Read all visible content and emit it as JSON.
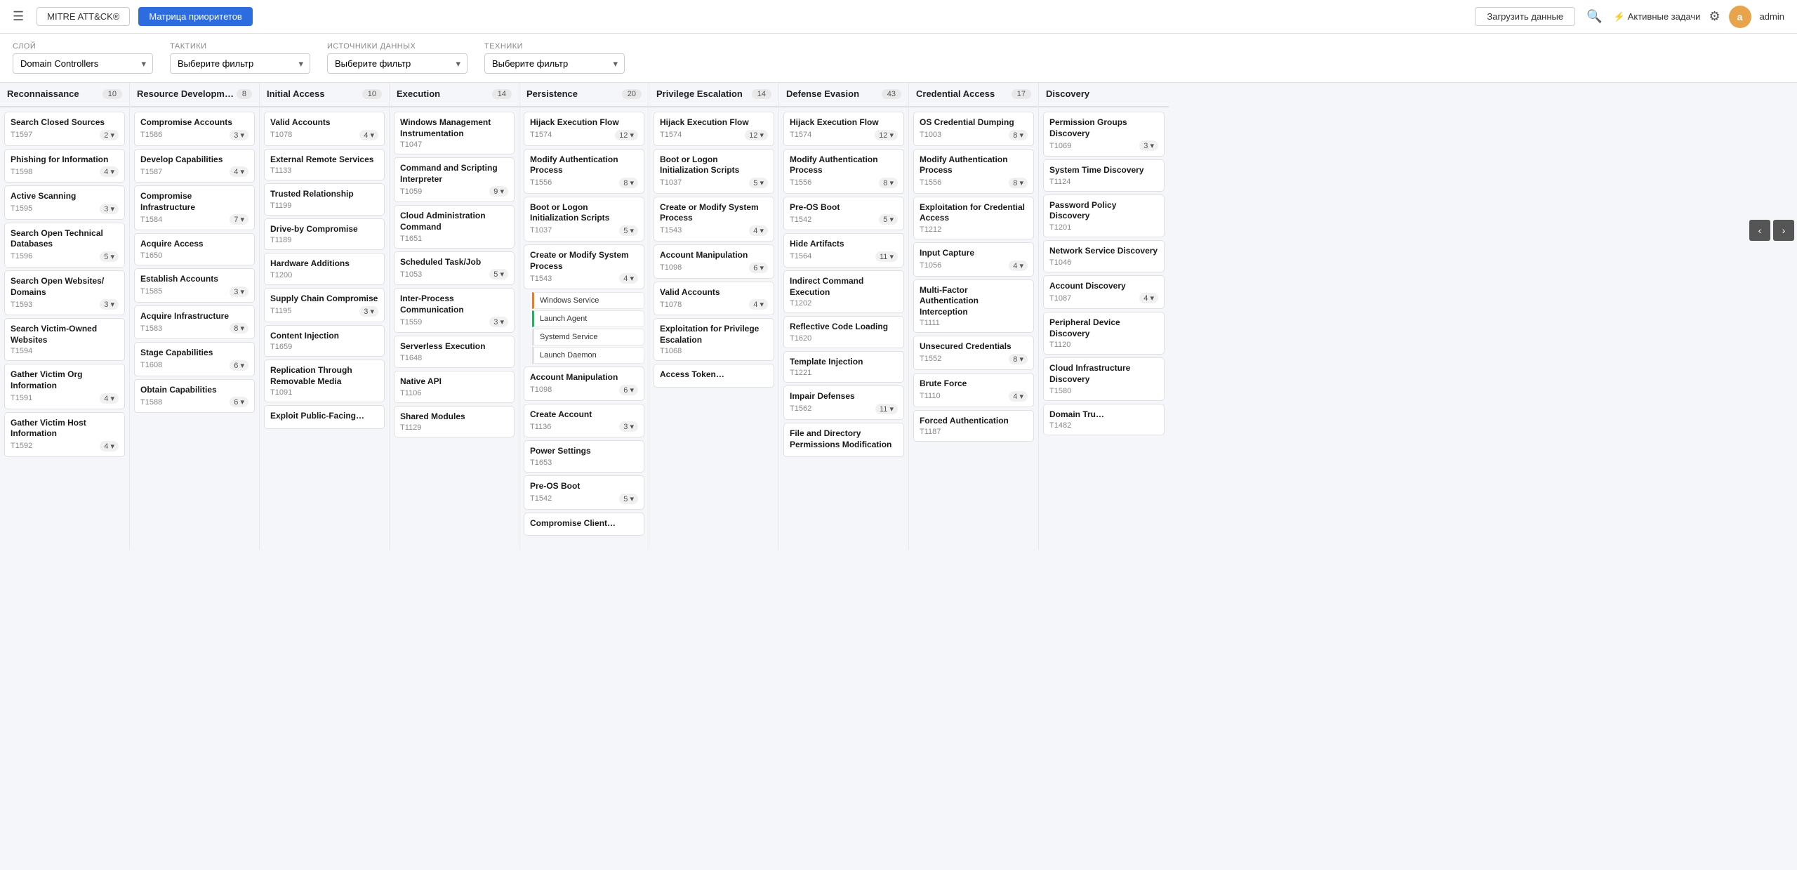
{
  "header": {
    "menu_icon": "☰",
    "brand": "MITRE ATT&CK®",
    "priority_matrix_tab": "Матрица приоритетов",
    "upload_btn": "Загрузить данные",
    "search_icon": "🔍",
    "active_tasks_label": "Активные задачи",
    "settings_icon": "⚙",
    "avatar_letter": "a",
    "admin_label": "admin"
  },
  "filters": {
    "layer_label": "Слой",
    "layer_value": "Domain Controllers",
    "tactics_label": "Тактики",
    "tactics_placeholder": "Выберите фильтр",
    "datasources_label": "Источники данных",
    "datasources_placeholder": "Выберите фильтр",
    "techniques_label": "Техники",
    "techniques_placeholder": "Выберите фильтр"
  },
  "columns": [
    {
      "id": "reconnaissance",
      "title": "Reconnaissance",
      "count": 10,
      "cards": [
        {
          "title": "Search Closed Sources",
          "id": "T1597",
          "count": 2,
          "expanded": false
        },
        {
          "title": "Phishing for Information",
          "id": "T1598",
          "count": 4,
          "expanded": false
        },
        {
          "title": "Active Scanning",
          "id": "T1595",
          "count": 3,
          "expanded": false
        },
        {
          "title": "Search Open Technical Databases",
          "id": "T1596",
          "count": 5,
          "expanded": false
        },
        {
          "title": "Search Open Websites/ Domains",
          "id": "T1593",
          "count": 3,
          "expanded": false
        },
        {
          "title": "Search Victim-Owned Websites",
          "id": "T1594",
          "count": null,
          "expanded": false
        },
        {
          "title": "Gather Victim Org Information",
          "id": "T1591",
          "count": 4,
          "expanded": false
        },
        {
          "title": "Gather Victim Host Information",
          "id": "T1592",
          "count": 4,
          "expanded": false
        }
      ]
    },
    {
      "id": "resource-development",
      "title": "Resource Developm…",
      "count": 8,
      "cards": [
        {
          "title": "Compromise Accounts",
          "id": "T1586",
          "count": 3,
          "expanded": false
        },
        {
          "title": "Develop Capabilities",
          "id": "T1587",
          "count": 4,
          "expanded": false
        },
        {
          "title": "Compromise Infrastructure",
          "id": "T1584",
          "count": 7,
          "expanded": false
        },
        {
          "title": "Acquire Access",
          "id": "T1650",
          "count": null,
          "expanded": false
        },
        {
          "title": "Establish Accounts",
          "id": "T1585",
          "count": 3,
          "expanded": false
        },
        {
          "title": "Acquire Infrastructure",
          "id": "T1583",
          "count": 8,
          "expanded": false
        },
        {
          "title": "Stage Capabilities",
          "id": "T1608",
          "count": 6,
          "expanded": false
        },
        {
          "title": "Obtain Capabilities",
          "id": "T1588",
          "count": 6,
          "expanded": false
        }
      ]
    },
    {
      "id": "initial-access",
      "title": "Initial Access",
      "count": 10,
      "cards": [
        {
          "title": "Valid Accounts",
          "id": "T1078",
          "count": 4,
          "expanded": false
        },
        {
          "title": "External Remote Services",
          "id": "T1133",
          "count": null,
          "expanded": false
        },
        {
          "title": "Trusted Relationship",
          "id": "T1199",
          "count": null,
          "expanded": false
        },
        {
          "title": "Drive-by Compromise",
          "id": "T1189",
          "count": null,
          "expanded": false
        },
        {
          "title": "Hardware Additions",
          "id": "T1200",
          "count": null,
          "expanded": false
        },
        {
          "title": "Supply Chain Compromise",
          "id": "T1195",
          "count": 3,
          "expanded": false
        },
        {
          "title": "Content Injection",
          "id": "T1659",
          "count": null,
          "expanded": false
        },
        {
          "title": "Replication Through Removable Media",
          "id": "T1091",
          "count": null,
          "expanded": false
        },
        {
          "title": "Exploit Public-Facing…",
          "id": "",
          "count": null,
          "expanded": false
        }
      ]
    },
    {
      "id": "execution",
      "title": "Execution",
      "count": 14,
      "cards": [
        {
          "title": "Windows Management Instrumentation",
          "id": "T1047",
          "count": null,
          "expanded": false
        },
        {
          "title": "Command and Scripting Interpreter",
          "id": "T1059",
          "count": 9,
          "expanded": false
        },
        {
          "title": "Cloud Administration Command",
          "id": "T1651",
          "count": null,
          "expanded": false
        },
        {
          "title": "Scheduled Task/Job",
          "id": "T1053",
          "count": 5,
          "expanded": false
        },
        {
          "title": "Inter-Process Communication",
          "id": "T1559",
          "count": 3,
          "expanded": false
        },
        {
          "title": "Serverless Execution",
          "id": "T1648",
          "count": null,
          "expanded": false
        },
        {
          "title": "Native API",
          "id": "T1106",
          "count": null,
          "expanded": false
        },
        {
          "title": "Shared Modules",
          "id": "T1129",
          "count": null,
          "expanded": false
        }
      ]
    },
    {
      "id": "persistence",
      "title": "Persistence",
      "count": 20,
      "cards": [
        {
          "title": "Hijack Execution Flow",
          "id": "T1574",
          "count": 12,
          "expanded": false
        },
        {
          "title": "Modify Authentication Process",
          "id": "T1556",
          "count": 8,
          "expanded": false
        },
        {
          "title": "Boot or Logon Initialization Scripts",
          "id": "T1037",
          "count": 5,
          "expanded": false
        },
        {
          "title": "Create or Modify System Process",
          "id": "T1543",
          "count": 4,
          "expanded": true,
          "subitems": [
            {
              "title": "Windows Service",
              "id": "",
              "highlight": "orange"
            },
            {
              "title": "Launch Agent",
              "id": "",
              "highlight": "green"
            },
            {
              "title": "Systemd Service",
              "id": "",
              "highlight": ""
            },
            {
              "title": "Launch Daemon",
              "id": "",
              "highlight": ""
            }
          ]
        },
        {
          "title": "Account Manipulation",
          "id": "T1098",
          "count": 6,
          "expanded": false
        },
        {
          "title": "Create Account",
          "id": "T1136",
          "count": 3,
          "expanded": false
        },
        {
          "title": "Power Settings",
          "id": "T1653",
          "count": null,
          "expanded": false
        },
        {
          "title": "Pre-OS Boot",
          "id": "T1542",
          "count": 5,
          "expanded": false
        },
        {
          "title": "Compromise Client…",
          "id": "",
          "count": null,
          "expanded": false
        }
      ]
    },
    {
      "id": "privilege-escalation",
      "title": "Privilege Escalation",
      "count": 14,
      "cards": [
        {
          "title": "Hijack Execution Flow",
          "id": "T1574",
          "count": 12,
          "expanded": false
        },
        {
          "title": "Boot or Logon Initialization Scripts",
          "id": "T1037",
          "count": 5,
          "expanded": false
        },
        {
          "title": "Create or Modify System Process",
          "id": "T1543",
          "count": 4,
          "expanded": false
        },
        {
          "title": "Account Manipulation",
          "id": "T1098",
          "count": 6,
          "expanded": false
        },
        {
          "title": "Valid Accounts",
          "id": "T1078",
          "count": 4,
          "expanded": false
        },
        {
          "title": "Exploitation for Privilege Escalation",
          "id": "T1068",
          "count": null,
          "expanded": false
        },
        {
          "title": "Access Token…",
          "id": "",
          "count": null,
          "expanded": false
        }
      ]
    },
    {
      "id": "defense-evasion",
      "title": "Defense Evasion",
      "count": 43,
      "cards": [
        {
          "title": "Hijack Execution Flow",
          "id": "T1574",
          "count": 12,
          "expanded": false
        },
        {
          "title": "Modify Authentication Process",
          "id": "T1556",
          "count": 8,
          "expanded": false
        },
        {
          "title": "Pre-OS Boot",
          "id": "T1542",
          "count": 5,
          "expanded": false
        },
        {
          "title": "Hide Artifacts",
          "id": "T1564",
          "count": 11,
          "expanded": false
        },
        {
          "title": "Indirect Command Execution",
          "id": "T1202",
          "count": null,
          "expanded": false
        },
        {
          "title": "Reflective Code Loading",
          "id": "T1620",
          "count": null,
          "expanded": false
        },
        {
          "title": "Template Injection",
          "id": "T1221",
          "count": null,
          "expanded": false
        },
        {
          "title": "Impair Defenses",
          "id": "T1562",
          "count": 11,
          "expanded": false
        },
        {
          "title": "File and Directory Permissions Modification",
          "id": "",
          "count": null,
          "expanded": false
        }
      ]
    },
    {
      "id": "credential-access",
      "title": "Credential Access",
      "count": 17,
      "cards": [
        {
          "title": "OS Credential Dumping",
          "id": "T1003",
          "count": 8,
          "expanded": false
        },
        {
          "title": "Modify Authentication Process",
          "id": "T1556",
          "count": 8,
          "expanded": false
        },
        {
          "title": "Exploitation for Credential Access",
          "id": "T1212",
          "count": null,
          "expanded": false
        },
        {
          "title": "Input Capture",
          "id": "T1056",
          "count": 4,
          "expanded": false
        },
        {
          "title": "Multi-Factor Authentication Interception",
          "id": "T1111",
          "count": null,
          "expanded": false
        },
        {
          "title": "Unsecured Credentials",
          "id": "T1552",
          "count": 8,
          "expanded": false
        },
        {
          "title": "Brute Force",
          "id": "T1110",
          "count": 4,
          "expanded": false
        },
        {
          "title": "Forced Authentication",
          "id": "T1187",
          "count": null,
          "expanded": false
        }
      ]
    },
    {
      "id": "discovery",
      "title": "Discovery",
      "count": null,
      "cards": [
        {
          "title": "Permission Groups Discovery",
          "id": "T1069",
          "count": 3,
          "expanded": false
        },
        {
          "title": "System Time Discovery",
          "id": "T1124",
          "count": null,
          "expanded": false
        },
        {
          "title": "Password Policy Discovery",
          "id": "T1201",
          "count": null,
          "expanded": false
        },
        {
          "title": "Network Service Discovery",
          "id": "T1046",
          "count": null,
          "expanded": false
        },
        {
          "title": "Account Discovery",
          "id": "T1087",
          "count": 4,
          "expanded": false
        },
        {
          "title": "Peripheral Device Discovery",
          "id": "T1120",
          "count": null,
          "expanded": false
        },
        {
          "title": "Cloud Infrastructure Discovery",
          "id": "T1580",
          "count": null,
          "expanded": false
        },
        {
          "title": "Domain Tru…",
          "id": "T1482",
          "count": null,
          "expanded": false
        }
      ]
    }
  ],
  "nav": {
    "prev_icon": "‹",
    "next_icon": "›"
  }
}
